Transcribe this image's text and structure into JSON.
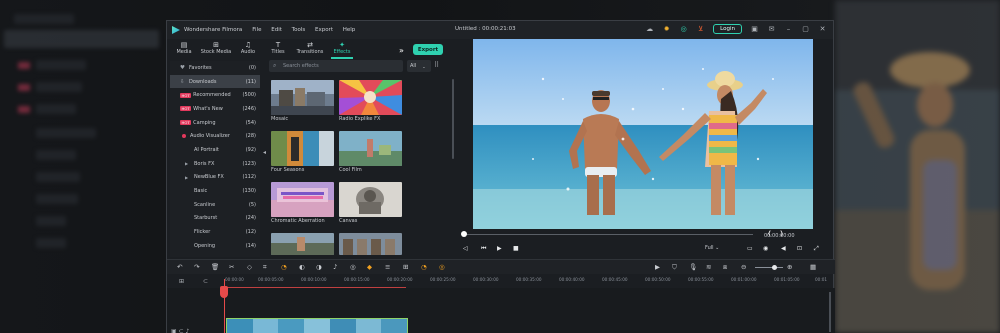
{
  "window": {
    "app_name": "Wondershare Filmora",
    "menu": [
      "File",
      "Edit",
      "Tools",
      "Export",
      "Help"
    ],
    "project_title": "Untitled : 00:00:21:03",
    "login_label": "Login"
  },
  "toolbar": {
    "tabs": [
      {
        "label": "Media",
        "icon": "media-icon"
      },
      {
        "label": "Stock Media",
        "icon": "stock-media-icon"
      },
      {
        "label": "Audio",
        "icon": "audio-icon"
      },
      {
        "label": "Titles",
        "icon": "titles-icon"
      },
      {
        "label": "Transitions",
        "icon": "transitions-icon"
      },
      {
        "label": "Effects",
        "icon": "effects-icon",
        "active": true
      }
    ],
    "export_label": "Export",
    "more_glyph": "»"
  },
  "categories": [
    {
      "label": "Favorites",
      "count": "(0)"
    },
    {
      "label": "Downloads",
      "count": "(11)",
      "selected": true
    },
    {
      "label": "Recommended",
      "count": "(500)",
      "badge": "HOT"
    },
    {
      "label": "What's New",
      "count": "(246)",
      "badge": "HOT"
    },
    {
      "label": "Camping",
      "count": "(54)",
      "badge": "HOT"
    },
    {
      "label": "Audio Visualizer",
      "count": "(28)"
    },
    {
      "label": "AI Portrait",
      "count": "(92)"
    },
    {
      "label": "Boris FX",
      "count": "(123)"
    },
    {
      "label": "NewBlue FX",
      "count": "(112)"
    },
    {
      "label": "Basic",
      "count": "(130)"
    },
    {
      "label": "Scanline",
      "count": "(5)"
    },
    {
      "label": "Starburst",
      "count": "(24)"
    },
    {
      "label": "Flicker",
      "count": "(12)"
    },
    {
      "label": "Opening",
      "count": "(14)"
    }
  ],
  "search": {
    "placeholder": "Search effects",
    "filter_value": "All"
  },
  "effects": [
    {
      "label": "Mosaic"
    },
    {
      "label": "Radio Explike FX"
    },
    {
      "label": "Four Seasons"
    },
    {
      "label": "Cool Film"
    },
    {
      "label": "Chromatic Aberration"
    },
    {
      "label": "Canvas"
    },
    {
      "label": ""
    },
    {
      "label": ""
    }
  ],
  "preview": {
    "timecode": "00:00:00:00",
    "quality": "Full"
  },
  "timeline": {
    "ticks": [
      "00:00:00",
      "00:00:05:00",
      "00:00:10:00",
      "00:00:15:00",
      "00:00:20:00",
      "00:00:25:00",
      "00:00:30:00",
      "00:00:35:00",
      "00:00:40:00",
      "00:00:45:00",
      "00:00:50:00",
      "00:00:55:00",
      "00:01:00:00",
      "00:01:05:00",
      "00:01"
    ]
  },
  "colors": {
    "accent": "#2fd1b0",
    "hot_badge": "#e2385c",
    "playhead": "#e54a4a",
    "clip_border": "#8fd36a"
  }
}
